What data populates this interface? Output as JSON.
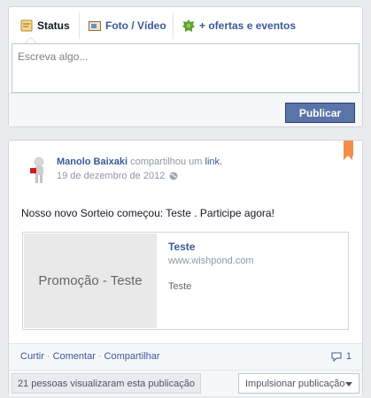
{
  "composer": {
    "tabs": [
      {
        "label": "Status",
        "icon": "status-icon"
      },
      {
        "label": "Foto / Vídeo",
        "icon": "photo-video-icon"
      },
      {
        "label": "+ ofertas e eventos",
        "icon": "offers-events-icon"
      }
    ],
    "placeholder": "Escreva algo...",
    "publish_label": "Publicar"
  },
  "post": {
    "author": "Manolo Baixaki",
    "action_text": "compartilhou um",
    "action_link": "link.",
    "date": "19 de dezembro de 2012",
    "text": "Nosso novo Sorteio começou: Teste . Participe agora!",
    "attachment": {
      "image_text": "Promoção - Teste",
      "title": "Teste",
      "url": "www.wishpond.com",
      "description": "Teste"
    },
    "actions": {
      "like": "Curtir",
      "comment": "Comentar",
      "share": "Compartilhar",
      "comments_count": "1"
    },
    "views_text": "21 pessoas visualizaram esta publicação",
    "boost_label": "Impulsionar publicação"
  },
  "colors": {
    "link": "#3b5998",
    "bookmark": "#f08e4a",
    "button": "#5b74a8"
  }
}
